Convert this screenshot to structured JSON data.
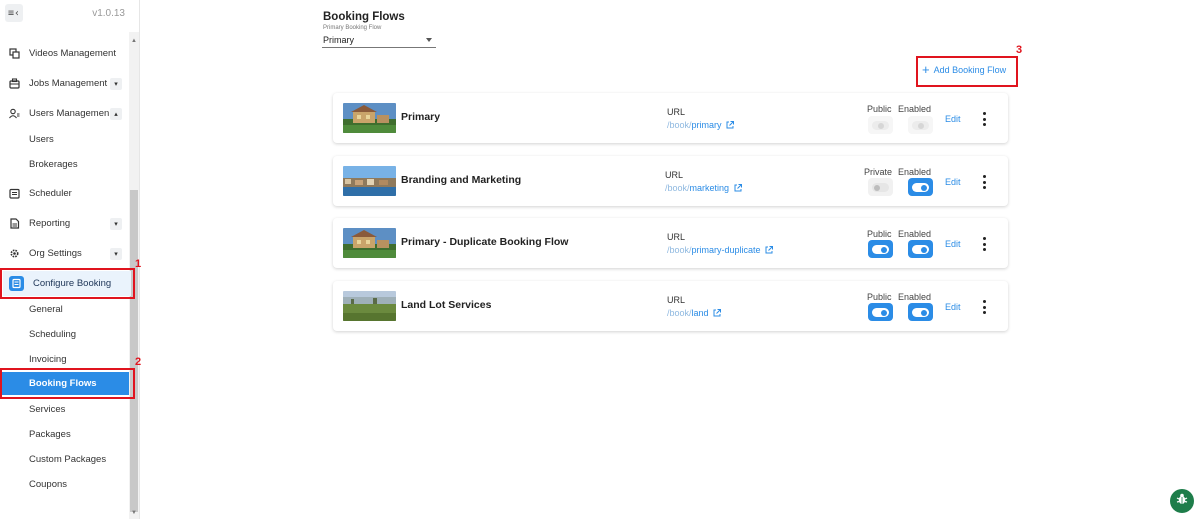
{
  "app": {
    "version": "v1.0.13"
  },
  "sidebar": {
    "items": [
      {
        "label": "Videos Management",
        "icon": "video-library-icon"
      },
      {
        "label": "Jobs Management",
        "icon": "briefcase-icon",
        "chevron": "down"
      },
      {
        "label": "Users Managemen",
        "icon": "users-icon",
        "chevron": "up"
      },
      {
        "label": "Users",
        "sub": true
      },
      {
        "label": "Brokerages",
        "sub": true
      },
      {
        "label": "Scheduler",
        "icon": "calendar-icon"
      },
      {
        "label": "Reporting",
        "icon": "report-icon",
        "chevron": "down"
      },
      {
        "label": "Org Settings",
        "icon": "gear-icon",
        "chevron": "down"
      },
      {
        "label": "Configure Booking",
        "icon": "booking-icon",
        "active": true
      },
      {
        "label": "General",
        "sub": true
      },
      {
        "label": "Scheduling",
        "sub": true
      },
      {
        "label": "Invoicing",
        "sub": true
      },
      {
        "label": "Booking Flows",
        "sub": true,
        "selected": true
      },
      {
        "label": "Services",
        "sub": true
      },
      {
        "label": "Packages",
        "sub": true
      },
      {
        "label": "Custom Packages",
        "sub": true
      },
      {
        "label": "Coupons",
        "sub": true
      }
    ]
  },
  "annotations": {
    "n1": "1",
    "n2": "2",
    "n3": "3"
  },
  "main": {
    "title": "Booking Flows",
    "select": {
      "label": "Primary Booking Flow",
      "value": "Primary"
    },
    "add_button": "Add Booking Flow",
    "cards": [
      {
        "name": "Primary",
        "url_label": "URL",
        "url_prefix": "/book/",
        "url_slug": "primary",
        "visibility_label": "Public",
        "enabled_label": "Enabled",
        "visibility_state": "disabled",
        "enabled_state": "disabled",
        "edit": "Edit",
        "thumb": "house"
      },
      {
        "name": "Branding and Marketing",
        "url_label": "URL",
        "url_prefix": "/book/",
        "url_slug": "marketing",
        "visibility_label": "Private",
        "enabled_label": "Enabled",
        "visibility_state": "off",
        "enabled_state": "on",
        "edit": "Edit",
        "thumb": "harbor"
      },
      {
        "name": "Primary - Duplicate Booking Flow",
        "url_label": "URL",
        "url_prefix": "/book/",
        "url_slug": "primary-duplicate",
        "visibility_label": "Public",
        "enabled_label": "Enabled",
        "visibility_state": "on",
        "enabled_state": "on",
        "edit": "Edit",
        "thumb": "house"
      },
      {
        "name": "Land Lot Services",
        "url_label": "URL",
        "url_prefix": "/book/",
        "url_slug": "land",
        "visibility_label": "Public",
        "enabled_label": "Enabled",
        "visibility_state": "on",
        "enabled_state": "on",
        "edit": "Edit",
        "thumb": "field"
      }
    ]
  },
  "colors": {
    "accent": "#2b8ce6",
    "annotation": "#e0141e",
    "bug_button": "#1e7d4a"
  }
}
